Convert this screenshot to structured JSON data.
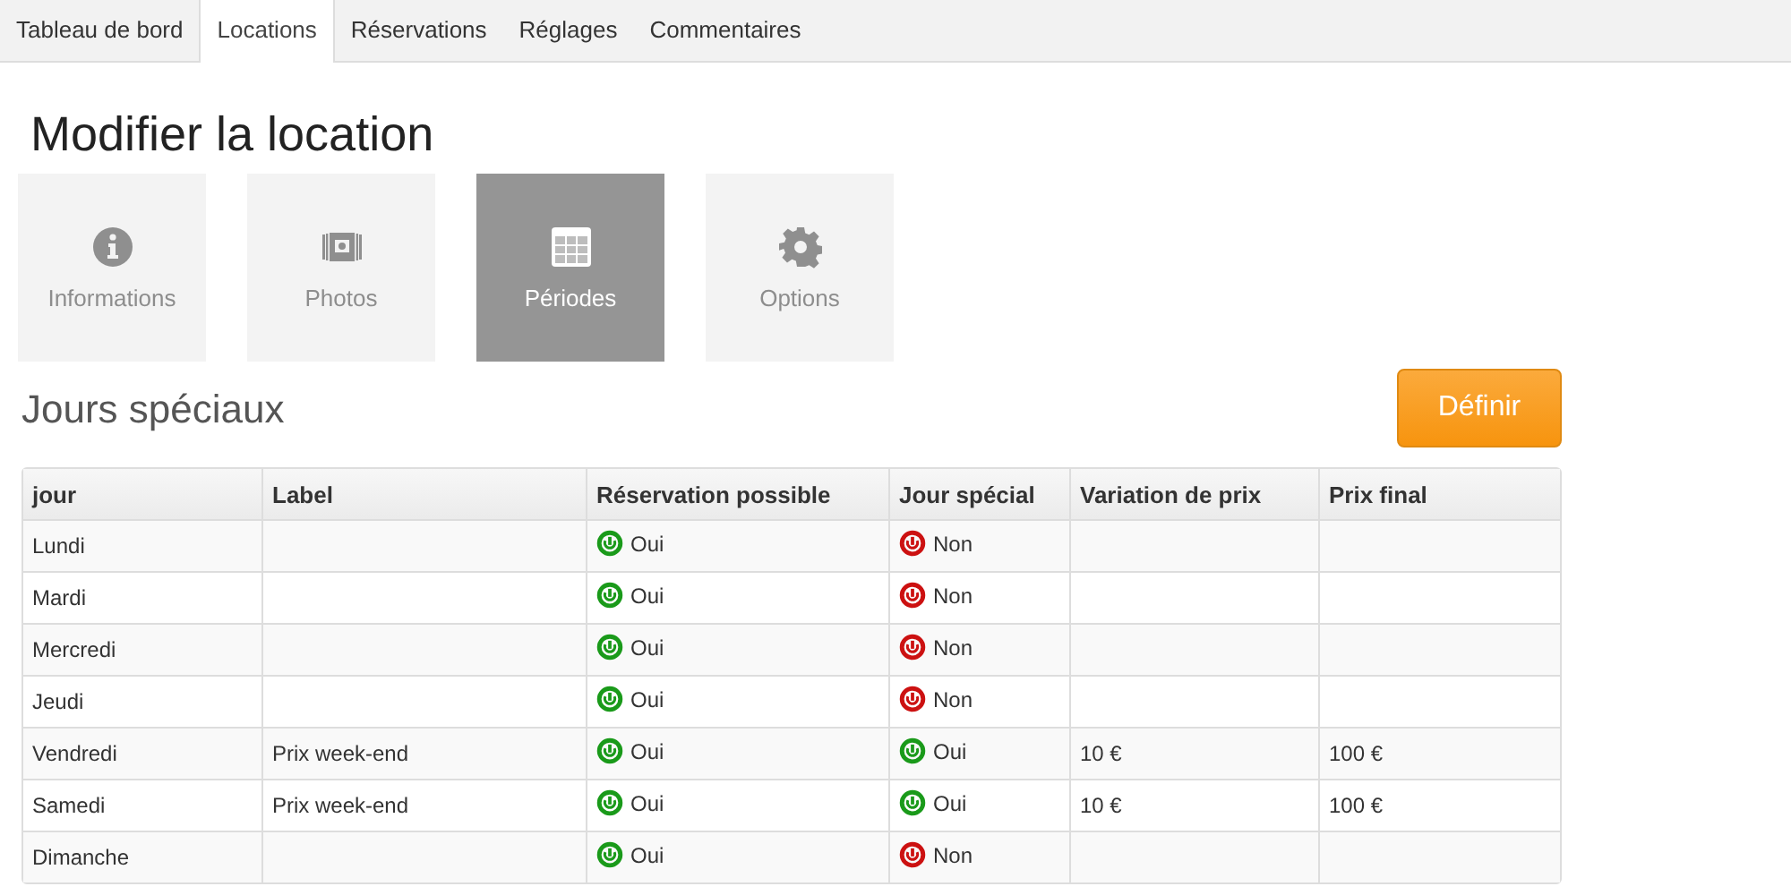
{
  "tabs": [
    {
      "label": "Tableau de bord",
      "selected": false
    },
    {
      "label": "Locations",
      "selected": true
    },
    {
      "label": "Réservations",
      "selected": false
    },
    {
      "label": "Réglages",
      "selected": false
    },
    {
      "label": "Commentaires",
      "selected": false
    }
  ],
  "title": "Modifier la location",
  "sections": [
    {
      "label": "Informations",
      "selected": false
    },
    {
      "label": "Photos",
      "selected": false
    },
    {
      "label": "Périodes",
      "selected": true
    },
    {
      "label": "Options",
      "selected": false
    }
  ],
  "subtitle": "Jours spéciaux",
  "define_button": "Définir",
  "table": {
    "columns": [
      "jour",
      "Label",
      "Réservation possible",
      "Jour spécial",
      "Variation de prix",
      "Prix final"
    ],
    "rows": [
      {
        "day": "Lundi",
        "booking": {
          "on": true,
          "text": "Oui"
        },
        "special": {
          "on": false,
          "text": "Non"
        }
      },
      {
        "day": "Mardi",
        "booking": {
          "on": true,
          "text": "Oui"
        },
        "special": {
          "on": false,
          "text": "Non"
        }
      },
      {
        "day": "Mercredi",
        "booking": {
          "on": true,
          "text": "Oui"
        },
        "special": {
          "on": false,
          "text": "Non"
        }
      },
      {
        "day": "Jeudi",
        "booking": {
          "on": true,
          "text": "Oui"
        },
        "special": {
          "on": false,
          "text": "Non"
        }
      },
      {
        "day": "Vendredi",
        "label": "Prix week-end",
        "booking": {
          "on": true,
          "text": "Oui"
        },
        "special": {
          "on": true,
          "text": "Oui"
        },
        "variation": "10 €",
        "final": "100 €"
      },
      {
        "day": "Samedi",
        "label": "Prix week-end",
        "booking": {
          "on": true,
          "text": "Oui"
        },
        "special": {
          "on": true,
          "text": "Oui"
        },
        "variation": "10 €",
        "final": "100 €"
      },
      {
        "day": "Dimanche",
        "booking": {
          "on": true,
          "text": "Oui"
        },
        "special": {
          "on": false,
          "text": "Non"
        }
      }
    ]
  }
}
